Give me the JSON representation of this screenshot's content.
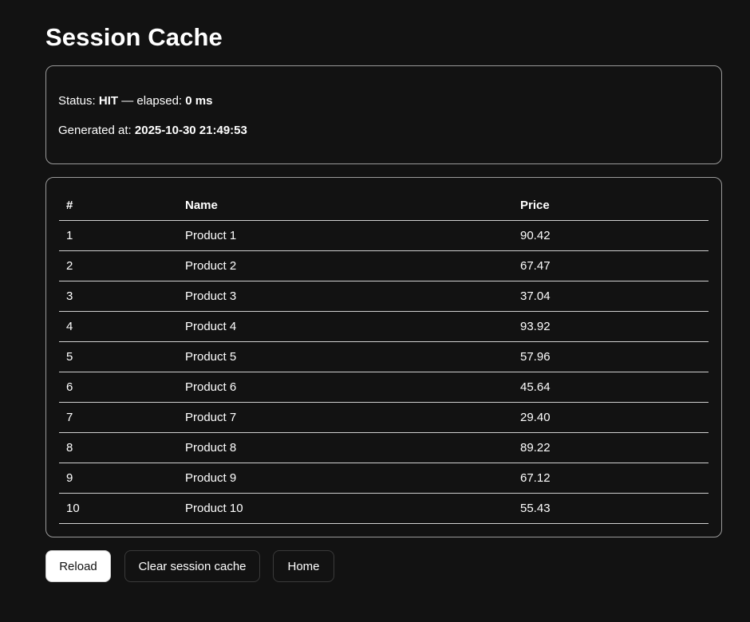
{
  "page": {
    "title": "Session Cache"
  },
  "status": {
    "status_label": "Status:",
    "status_value": "HIT",
    "elapsed_label": "— elapsed:",
    "elapsed_value": "0 ms",
    "generated_label": "Generated at:",
    "generated_value": "2025-10-30 21:49:53"
  },
  "table": {
    "headers": [
      "#",
      "Name",
      "Price"
    ],
    "rows": [
      [
        "1",
        "Product 1",
        "90.42"
      ],
      [
        "2",
        "Product 2",
        "67.47"
      ],
      [
        "3",
        "Product 3",
        "37.04"
      ],
      [
        "4",
        "Product 4",
        "93.92"
      ],
      [
        "5",
        "Product 5",
        "57.96"
      ],
      [
        "6",
        "Product 6",
        "45.64"
      ],
      [
        "7",
        "Product 7",
        "29.40"
      ],
      [
        "8",
        "Product 8",
        "89.22"
      ],
      [
        "9",
        "Product 9",
        "67.12"
      ],
      [
        "10",
        "Product 10",
        "55.43"
      ]
    ]
  },
  "actions": {
    "reload_label": "Reload",
    "clear_label": "Clear session cache",
    "home_label": "Home"
  }
}
